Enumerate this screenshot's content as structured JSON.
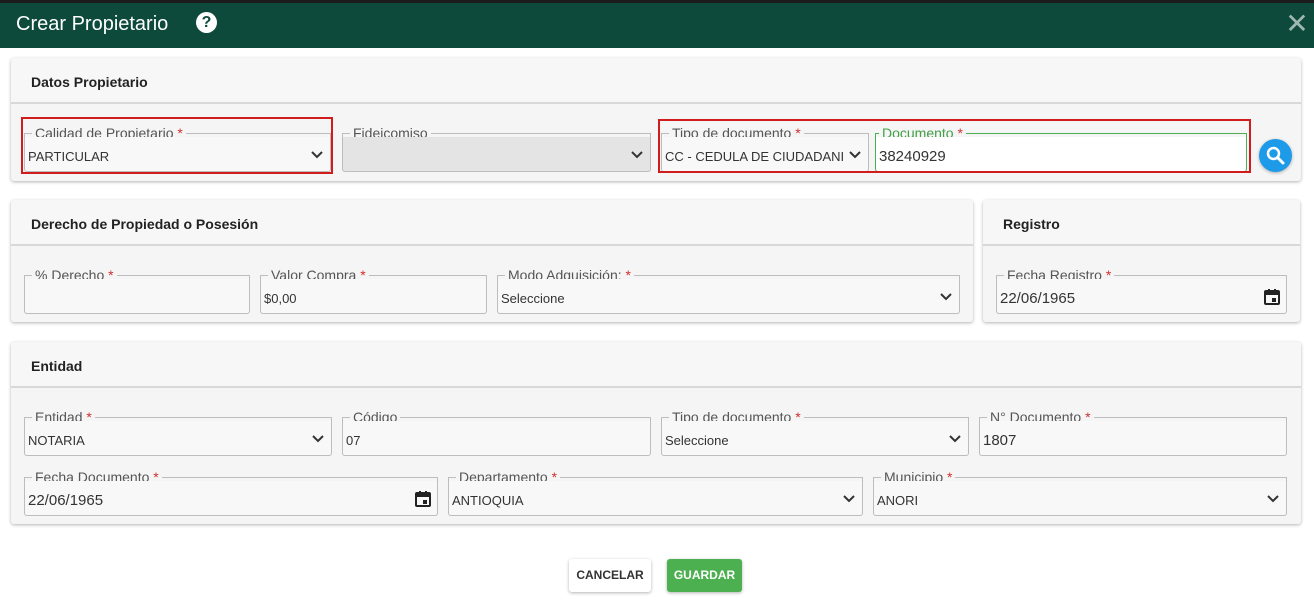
{
  "dialog": {
    "title": "Crear Propietario"
  },
  "sections": {
    "datos": "Datos Propietario",
    "derecho": "Derecho de Propiedad o Posesión",
    "registro": "Registro",
    "entidad": "Entidad"
  },
  "datos": {
    "calidad_label": "Calidad de Propietario",
    "calidad_value": "PARTICULAR",
    "fideicomiso_label": "Fideicomiso",
    "fideicomiso_value": "",
    "tipo_doc_label": "Tipo de documento",
    "tipo_doc_value": "CC - CEDULA DE CIUDADANIA",
    "documento_label": "Documento",
    "documento_value": "38240929"
  },
  "derecho": {
    "porcentaje_label": "% Derecho",
    "porcentaje_value": "",
    "valor_label": "Valor Compra",
    "valor_value": "$0,00",
    "modo_label": "Modo Adquisición:",
    "modo_value": "Seleccione"
  },
  "registro": {
    "fecha_label": "Fecha Registro",
    "fecha_value": "22/06/1965"
  },
  "entidad": {
    "entidad_label": "Entidad",
    "entidad_value": "NOTARIA",
    "codigo_label": "Código",
    "codigo_value": "07",
    "tipo_doc_label": "Tipo de documento",
    "tipo_doc_value": "Seleccione",
    "numero_label": "N° Documento",
    "numero_value": "1807",
    "fecha_label": "Fecha Documento",
    "fecha_value": "22/06/1965",
    "departamento_label": "Departamento",
    "departamento_value": "ANTIOQUIA",
    "municipio_label": "Municipio",
    "municipio_value": "ANORI"
  },
  "buttons": {
    "cancel": "CANCELAR",
    "save": "GUARDAR"
  },
  "colors": {
    "header": "#0d4a3c",
    "accent": "#4caf50",
    "search": "#1e9be8",
    "required": "#d32f2f",
    "highlight": "#d01c1c"
  }
}
